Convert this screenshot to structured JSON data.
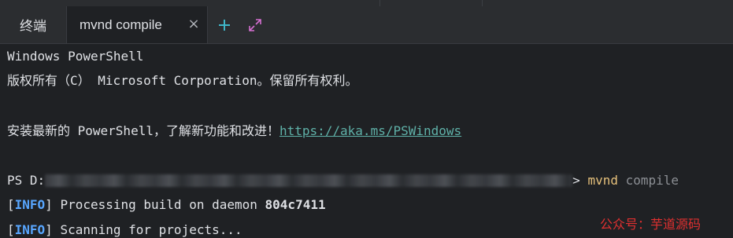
{
  "tabs": {
    "terminal_label": "终端",
    "active_tab_label": "mvnd compile",
    "close_glyph": "×",
    "new_tab_icon": "plus-icon",
    "maximize_icon": "expand-arrows-icon"
  },
  "terminal": {
    "line1": "Windows PowerShell",
    "line2": "版权所有（C） Microsoft Corporation。保留所有权利。",
    "line3_text": "安装最新的 PowerShell，了解新功能和改进！",
    "line3_link": "https://aka.ms/PSWindows",
    "prompt_prefix": "PS D:",
    "prompt_suffix": "> ",
    "command": "mvnd",
    "command_arg": "compile",
    "info_label": "INFO",
    "line5_text": "Processing build on daemon ",
    "daemon_id": "804c7411",
    "line6_text": "Scanning for projects..."
  },
  "watermark": "公众号：芋道源码",
  "colors": {
    "background": "#1f2124",
    "tabbar": "#2b2d30",
    "link": "#5fb1a8",
    "command": "#e5c07b",
    "info": "#58a6ff",
    "watermark": "#e03030"
  }
}
